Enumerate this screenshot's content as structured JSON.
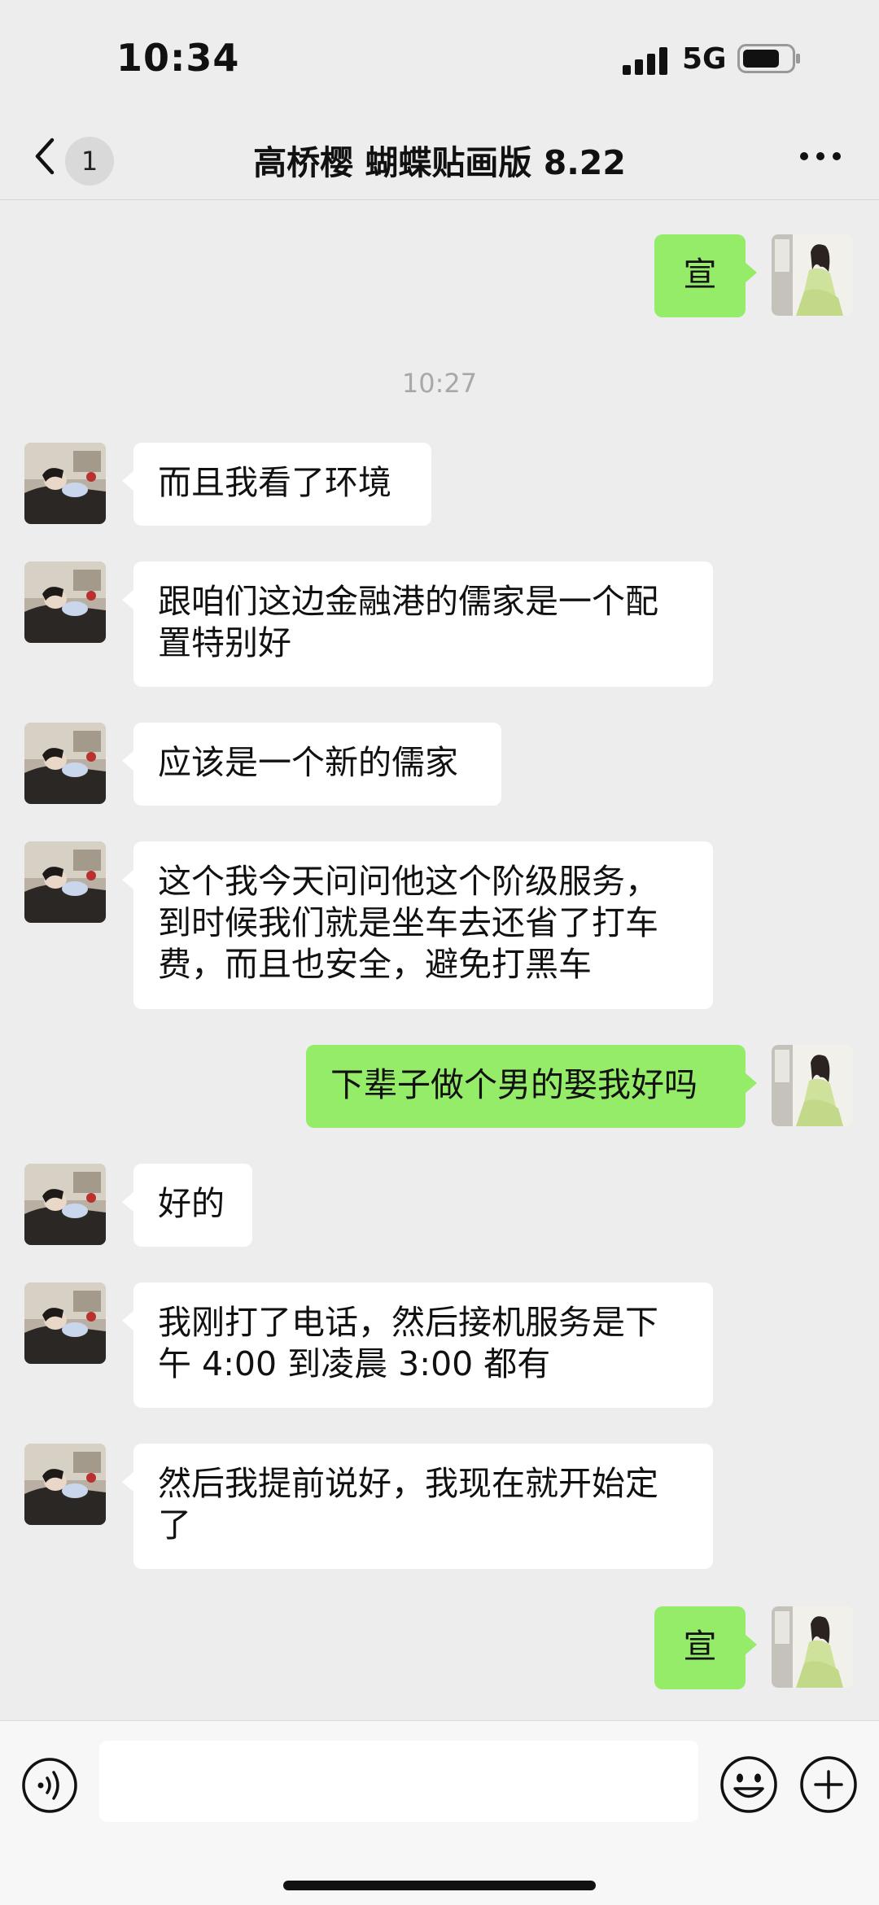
{
  "status_bar": {
    "time": "10:34",
    "network": "5G"
  },
  "nav": {
    "unread_count": "1",
    "title": "高桥樱 蝴蝶贴画版 8.22"
  },
  "chat": {
    "timestamp": "10:27",
    "messages": [
      {
        "side": "out",
        "text": "宣"
      },
      {
        "side": "in",
        "text": "而且我看了环境"
      },
      {
        "side": "in",
        "text": "跟咱们这边金融港的儒家是一个配置特别好"
      },
      {
        "side": "in",
        "text": "应该是一个新的儒家"
      },
      {
        "side": "in",
        "text": "这个我今天问问他这个阶级服务，到时候我们就是坐车去还省了打车费，而且也安全，避免打黑车"
      },
      {
        "side": "out",
        "text": "下辈子做个男的娶我好吗"
      },
      {
        "side": "in",
        "text": "好的"
      },
      {
        "side": "in",
        "text": "我刚打了电话，然后接机服务是下午 4:00 到凌晨 3:00 都有"
      },
      {
        "side": "in",
        "text": "然后我提前说好，我现在就开始定了"
      },
      {
        "side": "out",
        "text": "宣"
      }
    ]
  },
  "input": {
    "value": "",
    "placeholder": ""
  },
  "icons": {
    "back": "chevron-left-icon",
    "more": "more-horizontal-icon",
    "voice": "voice-icon",
    "emoji": "emoji-icon",
    "plus": "plus-icon"
  },
  "colors": {
    "background": "#ededed",
    "incoming_bubble": "#ffffff",
    "outgoing_bubble": "#95ec69",
    "timestamp": "#a8a8a8"
  }
}
